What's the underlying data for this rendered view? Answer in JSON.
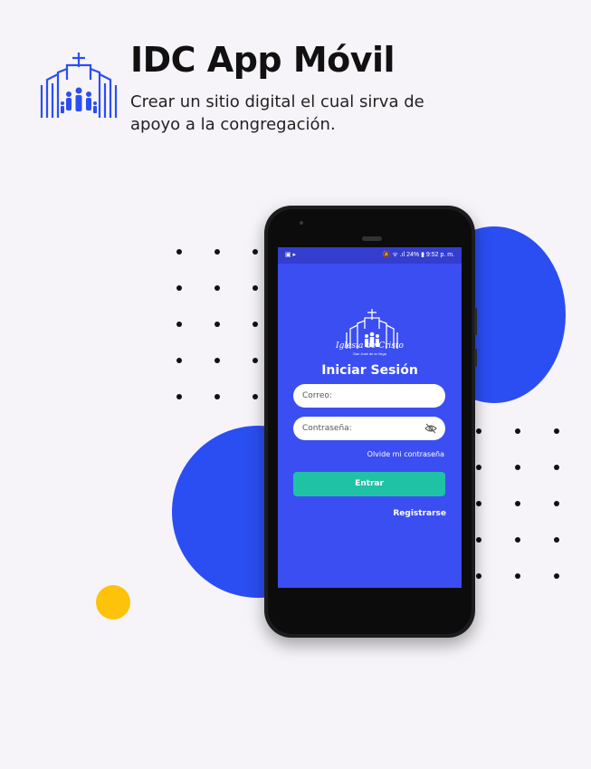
{
  "header": {
    "title": "IDC App Móvil",
    "subtitle": "Crear un sitio digital el cual sirva de apoyo a la congregación.",
    "logo_icon": "church-family-icon"
  },
  "colors": {
    "background": "#f6f4f8",
    "accent_blue": "#2b4ef3",
    "accent_yellow": "#fdc20a",
    "screen_blue": "#3b4ef2",
    "button_teal": "#20c2a6"
  },
  "phone": {
    "status": {
      "left": "▣ ▸",
      "right": "🔕 ᯤ .ıl 24% ▮ 9:52 p. m."
    },
    "app": {
      "brand": "Iglesia de Cristo",
      "brand_sub": "San José de la Vega",
      "login_title": "Iniciar Sesión",
      "email_placeholder": "Correo:",
      "password_placeholder": "Contraseña:",
      "forgot": "Olvide mi contraseña",
      "enter": "Entrar",
      "register": "Registrarse"
    }
  }
}
